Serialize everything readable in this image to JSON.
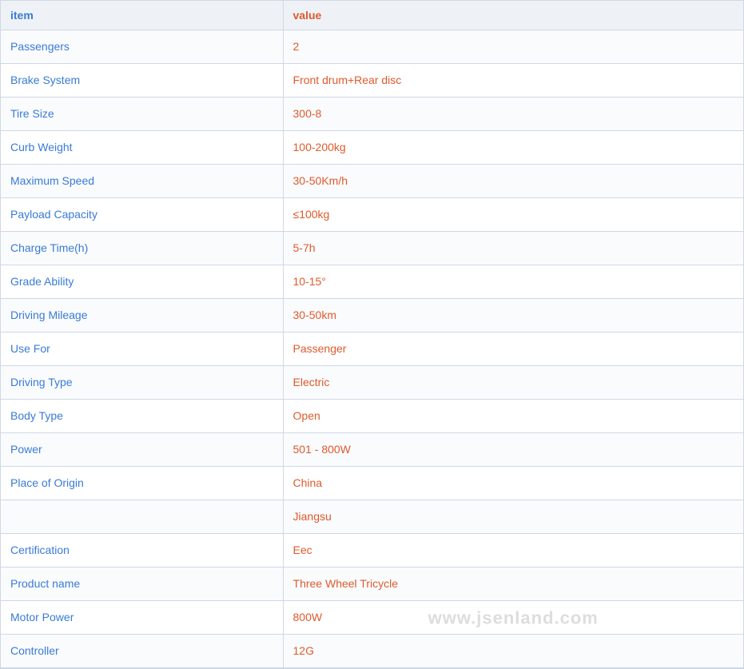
{
  "table": {
    "headers": {
      "item": "item",
      "value": "value"
    },
    "rows": [
      {
        "item": "Passengers",
        "value": "2"
      },
      {
        "item": "Brake System",
        "value": "Front drum+Rear disc"
      },
      {
        "item": "Tire Size",
        "value": "300-8"
      },
      {
        "item": "Curb Weight",
        "value": "100-200kg"
      },
      {
        "item": "Maximum Speed",
        "value": "30-50Km/h"
      },
      {
        "item": "Payload Capacity",
        "value": "≤100kg"
      },
      {
        "item": "Charge Time(h)",
        "value": "5-7h"
      },
      {
        "item": "Grade Ability",
        "value": "10-15°"
      },
      {
        "item": "Driving Mileage",
        "value": "30-50km"
      },
      {
        "item": "Use For",
        "value": "Passenger"
      },
      {
        "item": "Driving Type",
        "value": "Electric"
      },
      {
        "item": "Body Type",
        "value": "Open"
      },
      {
        "item": "Power",
        "value": "501 - 800W"
      },
      {
        "item": "Place of Origin",
        "value": "China"
      },
      {
        "item": "",
        "value": "Jiangsu"
      },
      {
        "item": "Certification",
        "value": "Eec"
      },
      {
        "item": "Product name",
        "value": "Three Wheel Tricycle"
      },
      {
        "item": "Motor Power",
        "value": "800W"
      },
      {
        "item": "Controller",
        "value": "12G"
      }
    ],
    "watermark": "www.jsenland.com"
  }
}
